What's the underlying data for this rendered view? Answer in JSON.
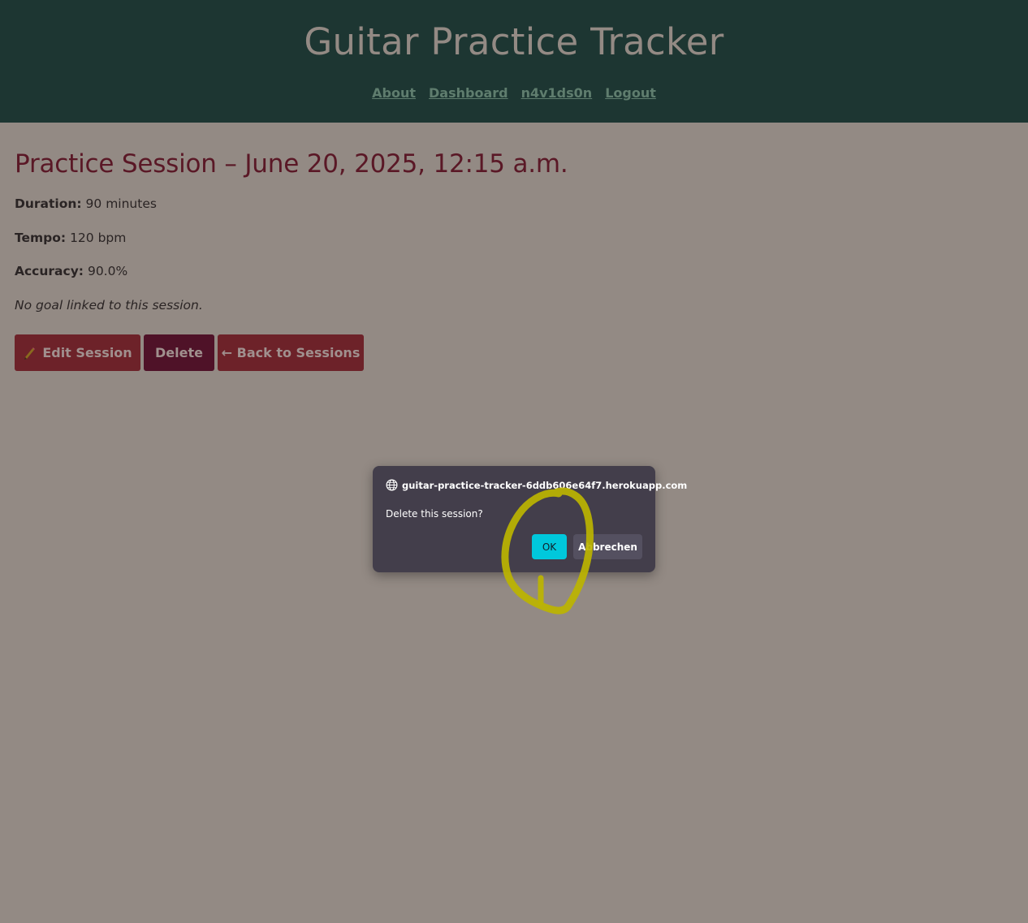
{
  "header": {
    "title": "Guitar Practice Tracker",
    "nav": [
      {
        "label": "About"
      },
      {
        "label": "Dashboard"
      },
      {
        "label": "n4v1ds0n"
      },
      {
        "label": "Logout"
      }
    ]
  },
  "session": {
    "title": "Practice Session – June 20, 2025, 12:15 a.m.",
    "duration_label": "Duration:",
    "duration_value": "90 minutes",
    "tempo_label": "Tempo:",
    "tempo_value": "120 bpm",
    "accuracy_label": "Accuracy:",
    "accuracy_value": "90.0%",
    "goal_note": "No goal linked to this session."
  },
  "actions": {
    "edit_label": "Edit Session",
    "delete_label": "Delete",
    "back_label": "← Back to Sessions"
  },
  "dialog": {
    "origin": "guitar-practice-tracker-6ddb606e64f7.herokuapp.com",
    "message": "Delete this session?",
    "ok_label": "OK",
    "cancel_label": "Abbrechen"
  },
  "colors": {
    "header_bg": "#1d3632",
    "page_bg_dimmed": "#938a84",
    "primary_button": "#6d2229",
    "danger_button": "#4f1228",
    "dialog_bg": "#433e4b",
    "ok_button": "#00c8dc",
    "annotation": "#bcb400"
  },
  "icons": {
    "edit": "pencil-icon",
    "dialog_origin": "globe-icon"
  }
}
